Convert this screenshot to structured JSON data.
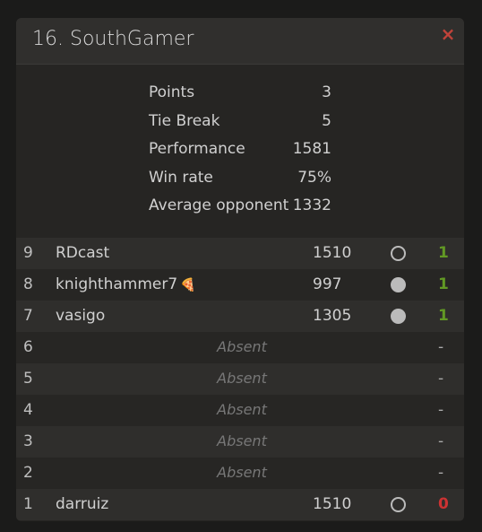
{
  "header": {
    "title": "16. SouthGamer",
    "close_label": "×"
  },
  "stats": [
    {
      "label": "Points",
      "value": "3"
    },
    {
      "label": "Tie Break",
      "value": "5"
    },
    {
      "label": "Performance",
      "value": "1581"
    },
    {
      "label": "Win rate",
      "value": "75%"
    },
    {
      "label": "Average opponent",
      "value": "1332"
    }
  ],
  "games": [
    {
      "round": "9",
      "opponent": "RDcast",
      "rating": "1510",
      "color": "white",
      "result": "1"
    },
    {
      "round": "8",
      "opponent": "knighthammer7",
      "badge": "🍕",
      "rating": "997",
      "color": "black",
      "result": "1"
    },
    {
      "round": "7",
      "opponent": "vasigo",
      "rating": "1305",
      "color": "black",
      "result": "1"
    },
    {
      "round": "6",
      "absent": "Absent",
      "result": "-"
    },
    {
      "round": "5",
      "absent": "Absent",
      "result": "-"
    },
    {
      "round": "4",
      "absent": "Absent",
      "result": "-"
    },
    {
      "round": "3",
      "absent": "Absent",
      "result": "-"
    },
    {
      "round": "2",
      "absent": "Absent",
      "result": "-"
    },
    {
      "round": "1",
      "opponent": "darruiz",
      "rating": "1510",
      "color": "white",
      "result": "0"
    }
  ]
}
